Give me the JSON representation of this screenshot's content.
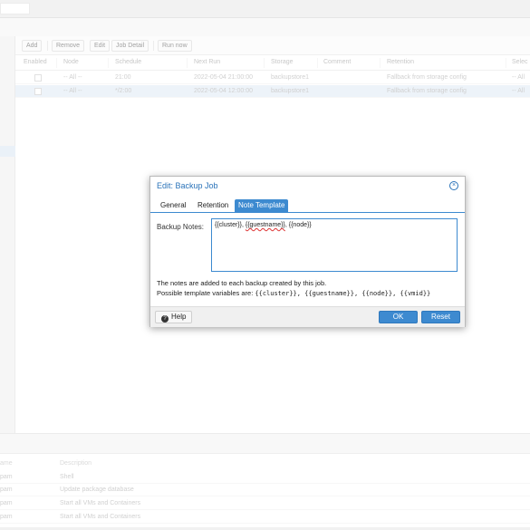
{
  "toolbar": {
    "add": "Add",
    "remove": "Remove",
    "edit": "Edit",
    "job_detail": "Job Detail",
    "run_now": "Run now"
  },
  "grid": {
    "columns": [
      "Enabled",
      "Node",
      "Schedule",
      "Next Run",
      "Storage",
      "Comment",
      "Retention",
      "Selec"
    ],
    "rows": [
      {
        "node": "-- All --",
        "schedule": "21:00",
        "next_run": "2022-05-04 21:00:00",
        "storage": "backupstore1",
        "comment": "",
        "retention": "Fallback from storage config",
        "selection": "-- All"
      },
      {
        "node": "-- All --",
        "schedule": "*/2:00",
        "next_run": "2022-05-04 12:00:00",
        "storage": "backupstore1",
        "comment": "",
        "retention": "Fallback from storage config",
        "selection": "-- All"
      }
    ]
  },
  "dialog": {
    "title": "Edit: Backup Job",
    "tabs": [
      "General",
      "Retention",
      "Note Template"
    ],
    "active_tab": "Note Template",
    "field_label": "Backup Notes:",
    "notes_part1": "{{cluster}}, ",
    "notes_part2": "{{guestname}}",
    "notes_part3": ", {{node}}",
    "help_line1": "The notes are added to each backup created by this job.",
    "help_line2_prefix": "Possible template variables are: ",
    "template_vars": "{{cluster}}, {{guestname}}, {{node}}, {{vmid}}",
    "help_button": "Help",
    "ok_button": "OK",
    "reset_button": "Reset"
  },
  "tasks": {
    "columns": [
      "ame",
      "Description"
    ],
    "rows": [
      {
        "user": "pam",
        "description": "Shell"
      },
      {
        "user": "pam",
        "description": "Update package database"
      },
      {
        "user": "pam",
        "description": "Start all VMs and Containers"
      },
      {
        "user": "pam",
        "description": "Start all VMs and Containers"
      }
    ]
  },
  "colors": {
    "accent": "#3d8ad0",
    "title": "#2a73b9",
    "selected_row": "#dfe9f4"
  },
  "icons": {
    "close": "close-circle-icon",
    "help": "question-circle-icon"
  }
}
